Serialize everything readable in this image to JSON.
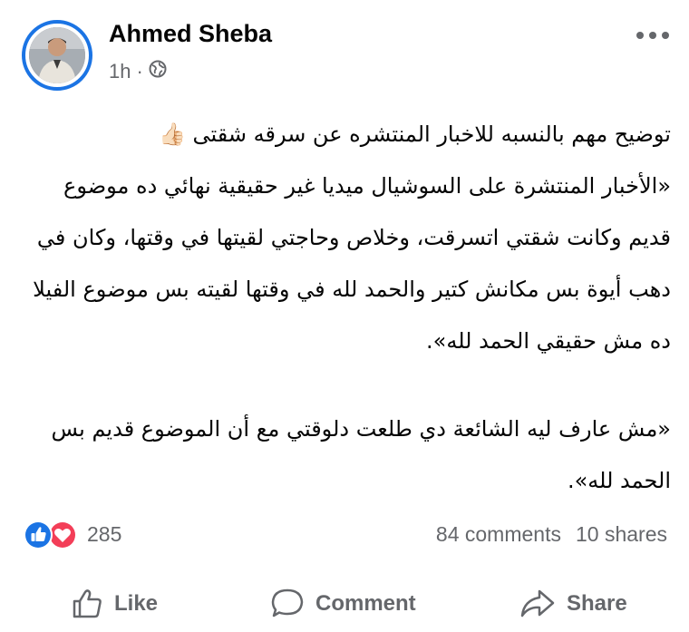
{
  "post": {
    "author": "Ahmed Sheba",
    "time": "1h",
    "separator": "·",
    "audience_icon": "globe-icon",
    "text_lines": [
      "توضيح مهم بالنسبه للاخبار المنتشره عن سرقه شقتى 👍🏻",
      "«الأخبار المنتشرة على السوشيال ميديا غير حقيقية نهائي ده موضوع قديم وكانت شقتي اتسرقت، وخلاص وحاجتي لقيتها في وقتها، وكان في دهب أيوة بس مكانش كتير والحمد لله في وقتها لقيته بس موضوع الفيلا ده مش حقيقي الحمد لله».",
      "«مش عارف ليه الشائعة دي طلعت دلوقتي مع أن الموضوع قديم بس الحمد لله»."
    ]
  },
  "stats": {
    "reactions_count": "285",
    "reaction_icons": [
      "like-icon",
      "love-icon"
    ],
    "comments": "84 comments",
    "shares": "10 shares"
  },
  "actions": {
    "like": "Like",
    "comment": "Comment",
    "share": "Share"
  },
  "colors": {
    "accent": "#1b74e4",
    "secondary_text": "#65676b",
    "love": "#f33e58"
  }
}
